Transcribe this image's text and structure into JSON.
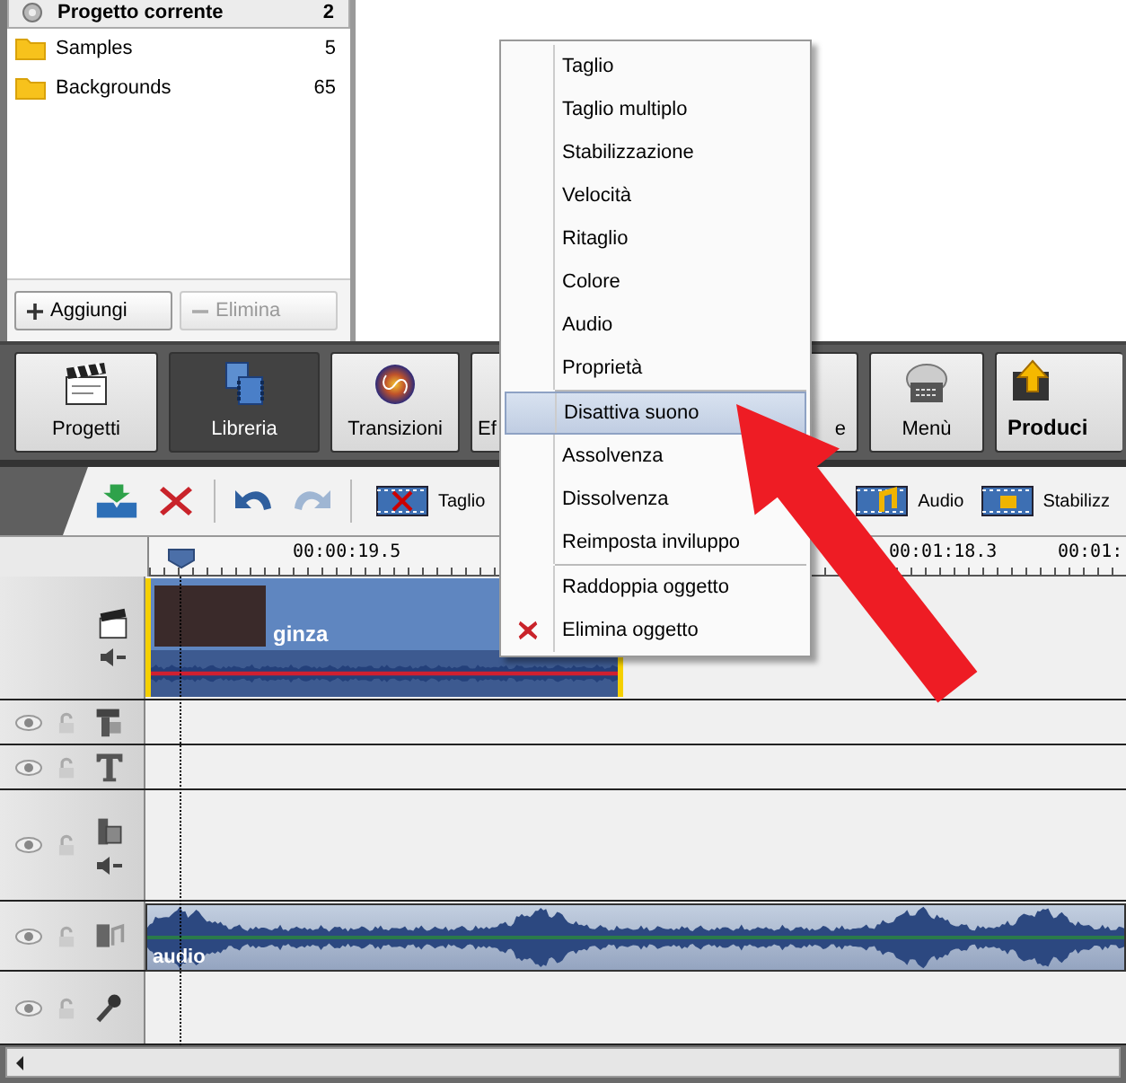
{
  "library": {
    "items": [
      {
        "name": "Progetto corrente",
        "count": "2",
        "kind": "project"
      },
      {
        "name": "Samples",
        "count": "5",
        "kind": "folder"
      },
      {
        "name": "Backgrounds",
        "count": "65",
        "kind": "folder"
      }
    ],
    "buttons": [
      {
        "label": "Aggiungi",
        "kind": "add",
        "disabled": false
      },
      {
        "label": "Elimina",
        "kind": "remove",
        "disabled": true
      }
    ]
  },
  "nav": {
    "buttons": [
      {
        "label": "Progetti",
        "kind": "projects",
        "selected": false
      },
      {
        "label": "Libreria",
        "kind": "library",
        "selected": true
      },
      {
        "label": "Transizioni",
        "kind": "transitions",
        "selected": false
      },
      {
        "label": "Ef",
        "kind": "covered-left",
        "selected": false
      },
      {
        "label": "e",
        "kind": "covered-right",
        "selected": false
      },
      {
        "label": "Menù",
        "kind": "menu",
        "selected": false
      },
      {
        "label": "Produci",
        "kind": "produce",
        "selected": false
      }
    ]
  },
  "toolbar": {
    "buttons": [
      {
        "label": "Taglio",
        "kind": "cut"
      },
      {
        "label": "Audio",
        "kind": "audio"
      },
      {
        "label": "Stabilizz",
        "kind": "stabilize"
      }
    ]
  },
  "ruler": {
    "labels": [
      "00:00:19.5",
      "00:01:18.3",
      "00:01:"
    ]
  },
  "tracks": [
    {
      "kind": "video",
      "clip": "ginza"
    },
    {
      "kind": "overlay"
    },
    {
      "kind": "text"
    },
    {
      "kind": "video2"
    },
    {
      "kind": "audio",
      "clip": "audio"
    },
    {
      "kind": "voice"
    }
  ],
  "context_menu": {
    "items": [
      {
        "kind": "item",
        "label": "Taglio",
        "selected": false
      },
      {
        "kind": "item",
        "label": "Taglio multiplo",
        "selected": false
      },
      {
        "kind": "item",
        "label": "Stabilizzazione",
        "selected": false
      },
      {
        "kind": "item",
        "label": "Velocità",
        "selected": false
      },
      {
        "kind": "item",
        "label": "Ritaglio",
        "selected": false
      },
      {
        "kind": "item",
        "label": "Colore",
        "selected": false
      },
      {
        "kind": "item",
        "label": "Audio",
        "selected": false
      },
      {
        "kind": "item",
        "label": "Proprietà",
        "selected": false
      },
      {
        "kind": "separator"
      },
      {
        "kind": "item",
        "label": "Disattiva suono",
        "selected": true
      },
      {
        "kind": "item",
        "label": "Assolvenza",
        "selected": false
      },
      {
        "kind": "item",
        "label": "Dissolvenza",
        "selected": false
      },
      {
        "kind": "item",
        "label": "Reimposta inviluppo",
        "selected": false
      },
      {
        "kind": "separator"
      },
      {
        "kind": "item",
        "label": "Raddoppia oggetto",
        "selected": false
      },
      {
        "kind": "delete",
        "label": "Elimina oggetto",
        "selected": false
      }
    ]
  }
}
